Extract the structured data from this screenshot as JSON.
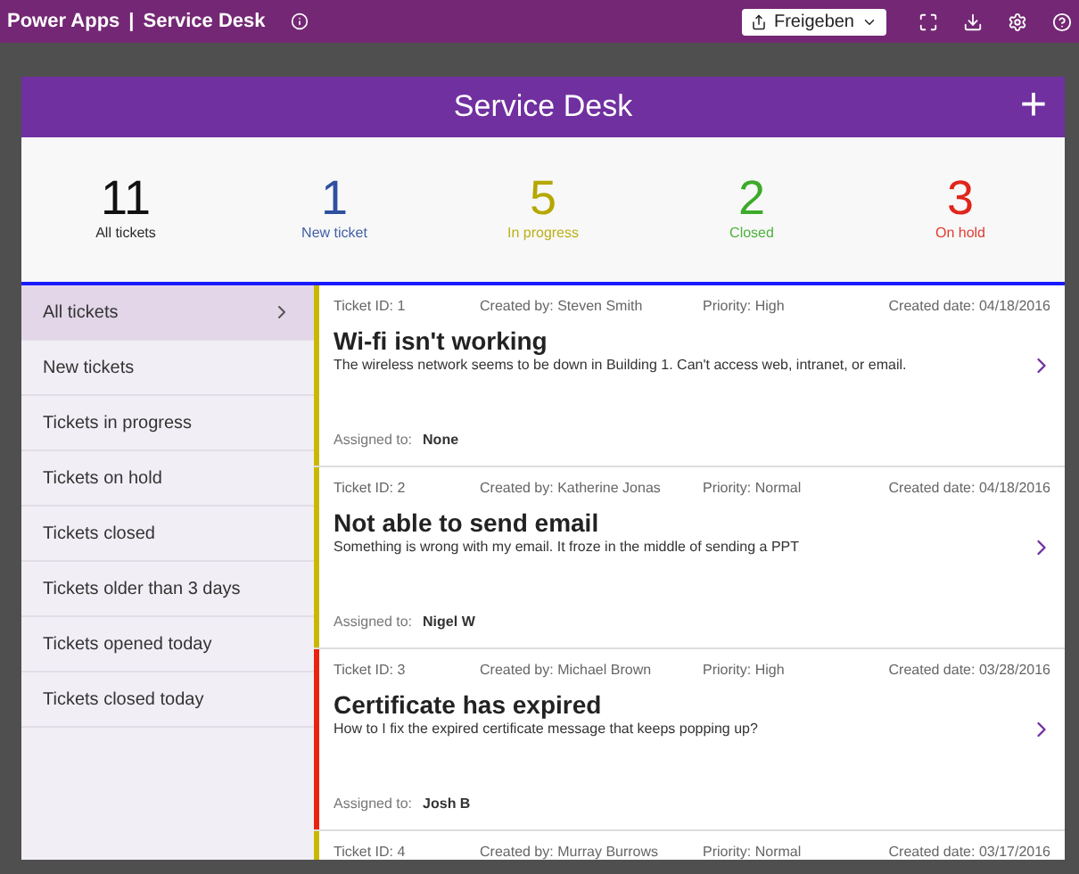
{
  "top_bar": {
    "app": "Power Apps",
    "separator": "|",
    "title": "Service Desk",
    "share_button": "Freigeben"
  },
  "header": {
    "title": "Service Desk",
    "add": "+"
  },
  "stats": [
    {
      "count": "11",
      "label": "All tickets",
      "color": "#111111"
    },
    {
      "count": "1",
      "label": "New ticket",
      "color": "#2f4f9f"
    },
    {
      "count": "5",
      "label": "In progress",
      "color": "#b5a800"
    },
    {
      "count": "2",
      "label": "Closed",
      "color": "#3caa2a"
    },
    {
      "count": "3",
      "label": "On hold",
      "color": "#e0261b"
    }
  ],
  "sidebar": {
    "items": [
      {
        "label": "All tickets",
        "selected": true
      },
      {
        "label": "New tickets",
        "selected": false
      },
      {
        "label": "Tickets in progress",
        "selected": false
      },
      {
        "label": "Tickets on hold",
        "selected": false
      },
      {
        "label": "Tickets closed",
        "selected": false
      },
      {
        "label": "Tickets older than 3 days",
        "selected": false
      },
      {
        "label": "Tickets opened today",
        "selected": false
      },
      {
        "label": "Tickets closed today",
        "selected": false
      }
    ]
  },
  "tickets": [
    {
      "id": "Ticket ID: 1",
      "created_by": "Created by: Steven Smith",
      "priority": "Priority: High",
      "created_date": "Created date: 04/18/2016",
      "title": "Wi-fi isn't working",
      "description": "The wireless network seems to be down in Building 1. Can't access web, intranet, or email.",
      "assigned_label": "Assigned to:",
      "assigned_to": "None",
      "color": "#c8b900"
    },
    {
      "id": "Ticket ID: 2",
      "created_by": "Created by: Katherine Jonas",
      "priority": "Priority: Normal",
      "created_date": "Created date: 04/18/2016",
      "title": "Not able to send email",
      "description": "Something is wrong with my email. It froze in the middle of sending a PPT",
      "assigned_label": "Assigned to:",
      "assigned_to": "Nigel W",
      "color": "#c8b900"
    },
    {
      "id": "Ticket ID: 3",
      "created_by": "Created by: Michael Brown",
      "priority": "Priority: High",
      "created_date": "Created date: 03/28/2016",
      "title": "Certificate has expired",
      "description": "How to I fix the expired certificate message that keeps popping up?",
      "assigned_label": "Assigned to:",
      "assigned_to": "Josh B",
      "color": "#e8230f"
    },
    {
      "id": "Ticket ID: 4",
      "created_by": "Created by: Murray Burrows",
      "priority": "Priority: Normal",
      "created_date": "Created date: 03/17/2016",
      "color": "#c8b900"
    }
  ]
}
